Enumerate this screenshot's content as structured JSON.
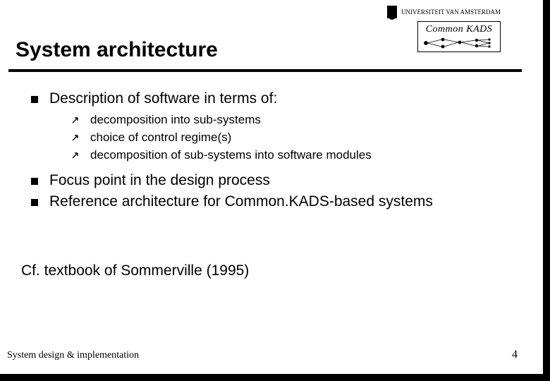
{
  "header": {
    "university": "UNIVERSITEIT VAN AMSTERDAM",
    "brand": "Common KADS"
  },
  "title": "System architecture",
  "bullets": [
    {
      "text": "Description of software in terms of:",
      "sub": [
        "decomposition into sub-systems",
        "choice of control regime(s)",
        "decomposition of sub-systems into software modules"
      ]
    },
    {
      "text": "Focus point in the design process"
    },
    {
      "text": "Reference architecture for Common.KADS-based systems"
    }
  ],
  "note": "Cf. textbook of Sommerville (1995)",
  "footer": {
    "left": "System design & implementation",
    "page": "4"
  }
}
